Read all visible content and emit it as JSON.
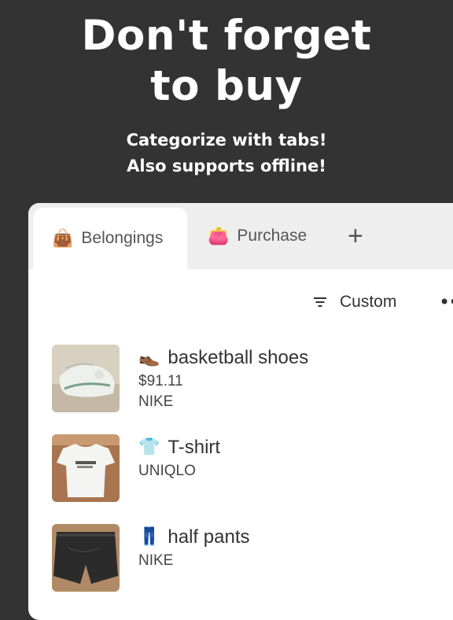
{
  "headline": {
    "line1": "Don't forget",
    "line2": "to buy"
  },
  "subline": {
    "line1": "Categorize with tabs!",
    "line2": "Also supports offline!"
  },
  "tabs": [
    {
      "emoji": "👜",
      "label": "Belongings",
      "active": true
    },
    {
      "emoji": "👛",
      "label": "Purchase",
      "active": false
    }
  ],
  "add_tab": "+",
  "sort": {
    "label": "Custom",
    "icon": "filter-icon"
  },
  "more": "••",
  "items": [
    {
      "emoji": "👞",
      "name": "basketball shoes",
      "price": "$91.11",
      "brand": "NIKE",
      "thumb_bg": "#cfc7b8"
    },
    {
      "emoji": "👕",
      "name": "T-shirt",
      "brand": "UNIQLO",
      "thumb_bg": "#b9845a"
    },
    {
      "emoji": "👖",
      "name": "half pants",
      "brand": "NIKE",
      "thumb_bg": "#3a3a3a"
    }
  ]
}
